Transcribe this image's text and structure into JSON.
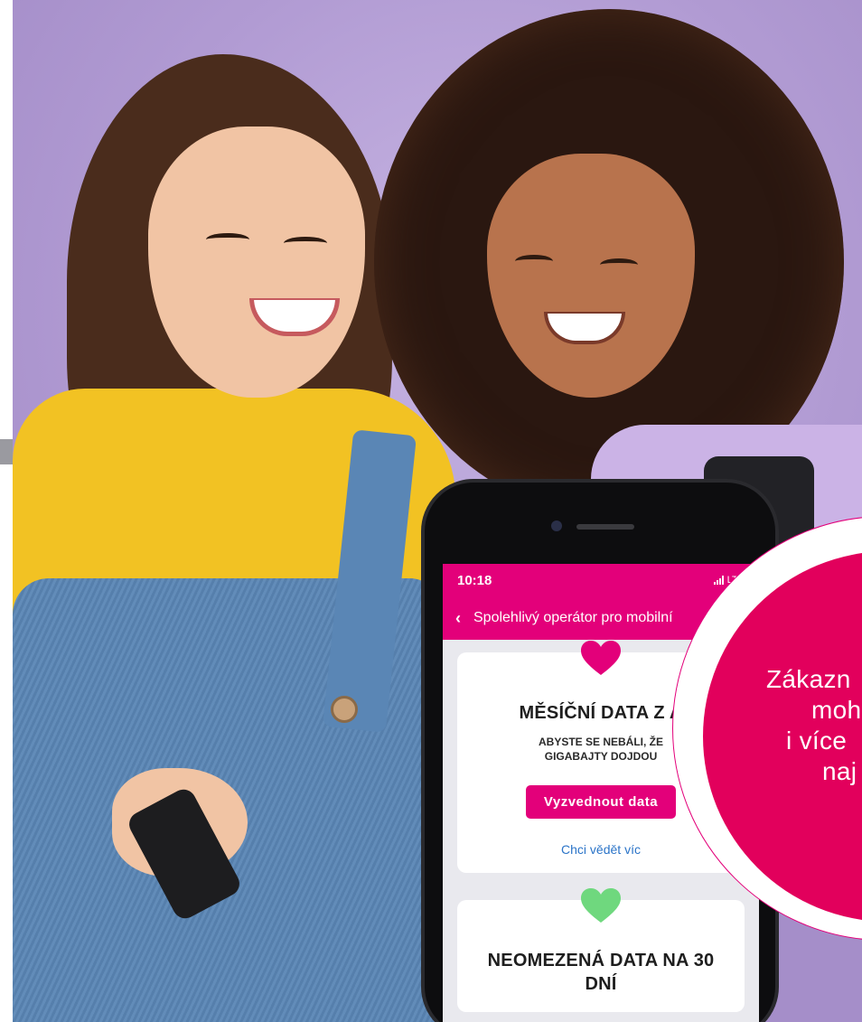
{
  "phone": {
    "status_time": "10:18",
    "status_network": "LTE",
    "nav_title": "Spolehlivý operátor pro mobilní",
    "cards": [
      {
        "heart_color": "#e3007a",
        "title": "MĚSÍČNÍ DATA Z A",
        "subtitle_line1": "ABYSTE SE NEBÁLI, ŽE",
        "subtitle_line2": "GIGABAJTY DOJDOU",
        "button_label": "Vyzvednout data",
        "link_label": "Chci vědět víc"
      },
      {
        "heart_color": "#6fd87e",
        "title_line1": "NEOMEZENÁ DATA NA 30",
        "title_line2": "DNÍ"
      }
    ]
  },
  "promo": {
    "line1": "Zákazn",
    "line2": "moho",
    "line3": "i více",
    "line4": "naj"
  },
  "colors": {
    "brand_magenta": "#e3007a",
    "promo_magenta": "#e2005c",
    "link_blue": "#2b74c8"
  }
}
